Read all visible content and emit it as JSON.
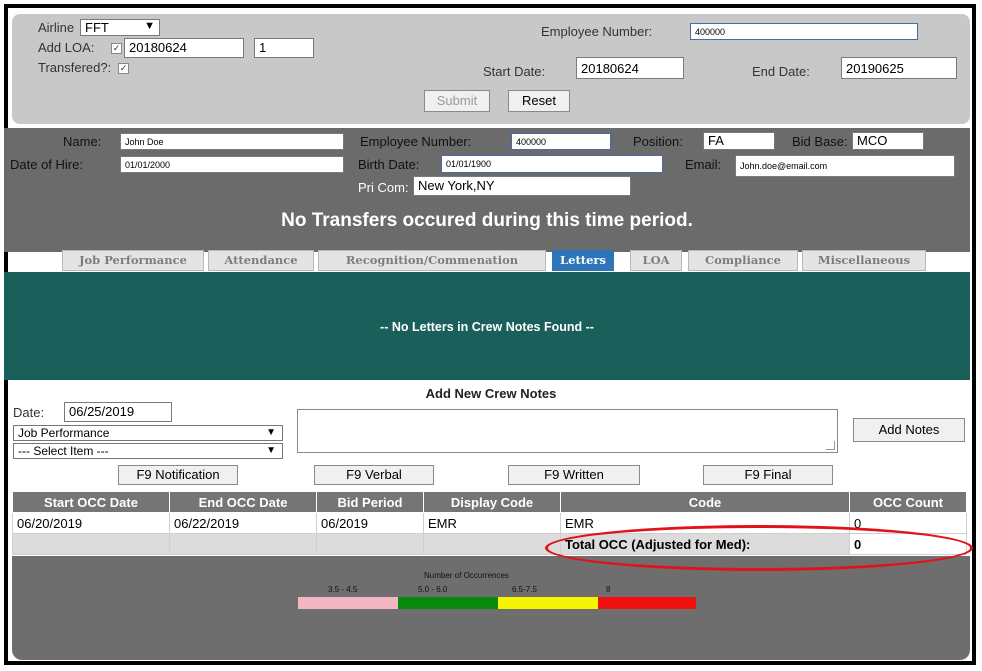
{
  "top": {
    "airline_label": "Airline",
    "airline_value": "FFT",
    "add_loa_label": "Add LOA:",
    "add_loa_value1": "20180624",
    "add_loa_value2": "1",
    "transfered_label": "Transfered?:",
    "employee_number_label": "Employee Number:",
    "employee_number_value": "400000",
    "start_date_label": "Start Date:",
    "start_date_value": "20180624",
    "end_date_label": "End Date:",
    "end_date_value": "20190625",
    "submit_label": "Submit",
    "reset_label": "Reset"
  },
  "info": {
    "name_label": "Name:",
    "name_value": "John Doe",
    "employee_number_label": "Employee Number:",
    "employee_number_value": "400000",
    "position_label": "Position:",
    "position_value": "FA",
    "bid_base_label": "Bid Base:",
    "bid_base_value": "MCO",
    "date_of_hire_label": "Date of Hire:",
    "date_of_hire_value": "01/01/2000",
    "birth_date_label": "Birth Date:",
    "birth_date_value": "01/01/1900",
    "email_label": "Email:",
    "email_value": "John.doe@email.com",
    "pri_com_label": "Pri Com:",
    "pri_com_value": "New York,NY",
    "banner": "No Transfers occured during this time period."
  },
  "tabs": [
    {
      "label": "Job Performance"
    },
    {
      "label": "Attendance"
    },
    {
      "label": "Recognition/Commenation"
    },
    {
      "label": "Letters"
    },
    {
      "label": "LOA"
    },
    {
      "label": "Compliance"
    },
    {
      "label": "Miscellaneous"
    }
  ],
  "letters_message": "-- No Letters in Crew Notes Found --",
  "crew_notes": {
    "title": "Add New Crew Notes",
    "date_label": "Date:",
    "date_value": "06/25/2019",
    "category_select": "Job Performance",
    "item_select": "--- Select Item ---",
    "add_notes_label": "Add Notes"
  },
  "f9_buttons": [
    "F9 Notification",
    "F9 Verbal",
    "F9 Written",
    "F9 Final"
  ],
  "table": {
    "headers": [
      "Start OCC Date",
      "End OCC Date",
      "Bid Period",
      "Display Code",
      "Code",
      "OCC Count"
    ],
    "rows": [
      [
        "06/20/2019",
        "06/22/2019",
        "06/2019",
        "EMR",
        "EMR",
        "0"
      ]
    ],
    "total_label": "Total OCC (Adjusted for Med):",
    "total_value": "0"
  },
  "legend": {
    "title": "Number of Occurrences",
    "segments": [
      {
        "label": "3.5 - 4.5",
        "color": "#f4b6c2"
      },
      {
        "label": "5.0 - 6.0",
        "color": "#0a8a0a"
      },
      {
        "label": "6.5-7.5",
        "color": "#f5f500"
      },
      {
        "label": "8",
        "color": "#f01010"
      }
    ]
  },
  "colors": {
    "teal_panel": "#1b5f5b",
    "active_tab": "#2e74b8",
    "highlight": "#e0131b"
  }
}
